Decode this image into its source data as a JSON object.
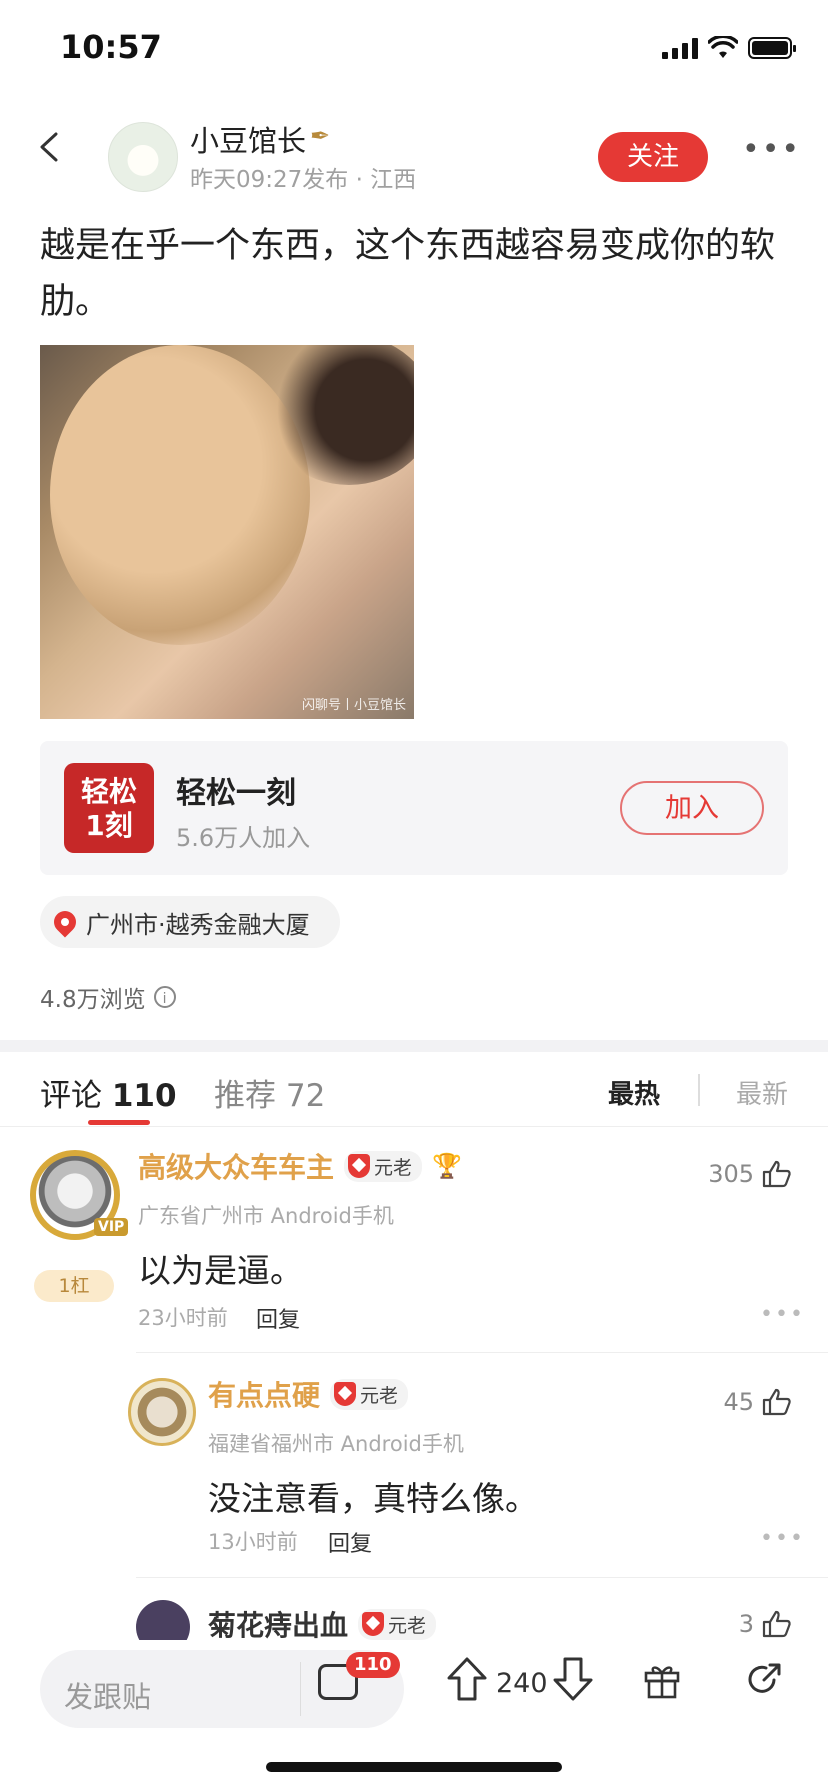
{
  "status_bar": {
    "time": "10:57"
  },
  "post": {
    "author": "小豆馆长",
    "meta": "昨天09:27发布 · 江西",
    "follow_label": "关注",
    "text": "越是在乎一个东西，这个东西越容易变成你的软肋。",
    "image_watermark": "闪聊号丨小豆馆长",
    "views": "4.8万浏览"
  },
  "group": {
    "logo_text_1": "轻松",
    "logo_text_2": "1刻",
    "name": "轻松一刻",
    "members": "5.6万人加入",
    "join_label": "加入"
  },
  "location": {
    "text": "广州市·越秀金融大厦"
  },
  "tabs": {
    "comments_label": "评论",
    "comments_count": "110",
    "recommend_label": "推荐",
    "recommend_count": "72",
    "sort_hot": "最热",
    "sort_new": "最新"
  },
  "comments": [
    {
      "name": "高级大众车车主",
      "badge": "元老",
      "location": "广东省广州市 Android手机",
      "text": "以为是逼。",
      "time": "23小时前",
      "reply": "回复",
      "likes": "305",
      "rank": "1杠",
      "vip": "VIP"
    },
    {
      "name": "有点点硬",
      "badge": "元老",
      "location": "福建省福州市 Android手机",
      "text": "没注意看，真特么像。",
      "time": "13小时前",
      "reply": "回复",
      "likes": "45"
    },
    {
      "name": "菊花痔出血",
      "badge": "元老",
      "likes": "3"
    }
  ],
  "bottom_bar": {
    "reply_placeholder": "发跟贴",
    "comment_badge": "110",
    "vote_count": "240"
  },
  "colors": {
    "accent": "#e53935",
    "username": "#e0a14a"
  }
}
